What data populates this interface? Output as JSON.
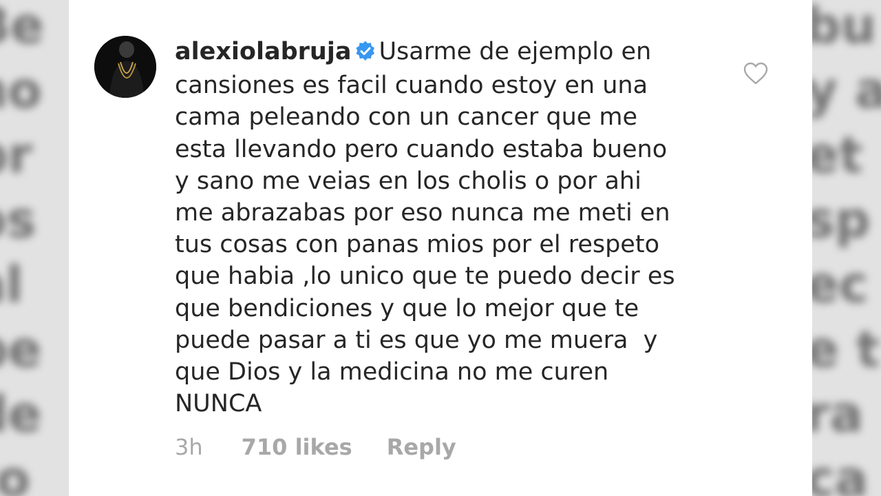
{
  "comment": {
    "username": "alexiolabruja",
    "verified": true,
    "text": "Usarme de ejemplo en\ncansiones es facil cuando estoy en una\ncama peleando con un cancer que me\nesta llevando pero cuando estaba bueno\ny sano me veias en los cholis o por ahi\nme abrazabas por eso nunca me meti en\ntus cosas con panas mios por el respeto\nque habia ,lo unico que te puedo decir es\nque bendiciones y que lo mejor que te\npuede pasar a ti es que yo me muera  y\nque Dios y la medicina no me curen\nNUNCA",
    "time": "3h",
    "likes": "710 likes",
    "reply_label": "Reply"
  },
  "icons": {
    "verified": "verified-badge-icon",
    "like": "heart-outline-icon"
  },
  "colors": {
    "verified_blue": "#3897f0",
    "text": "#262626",
    "meta": "#a8a8a8"
  }
}
